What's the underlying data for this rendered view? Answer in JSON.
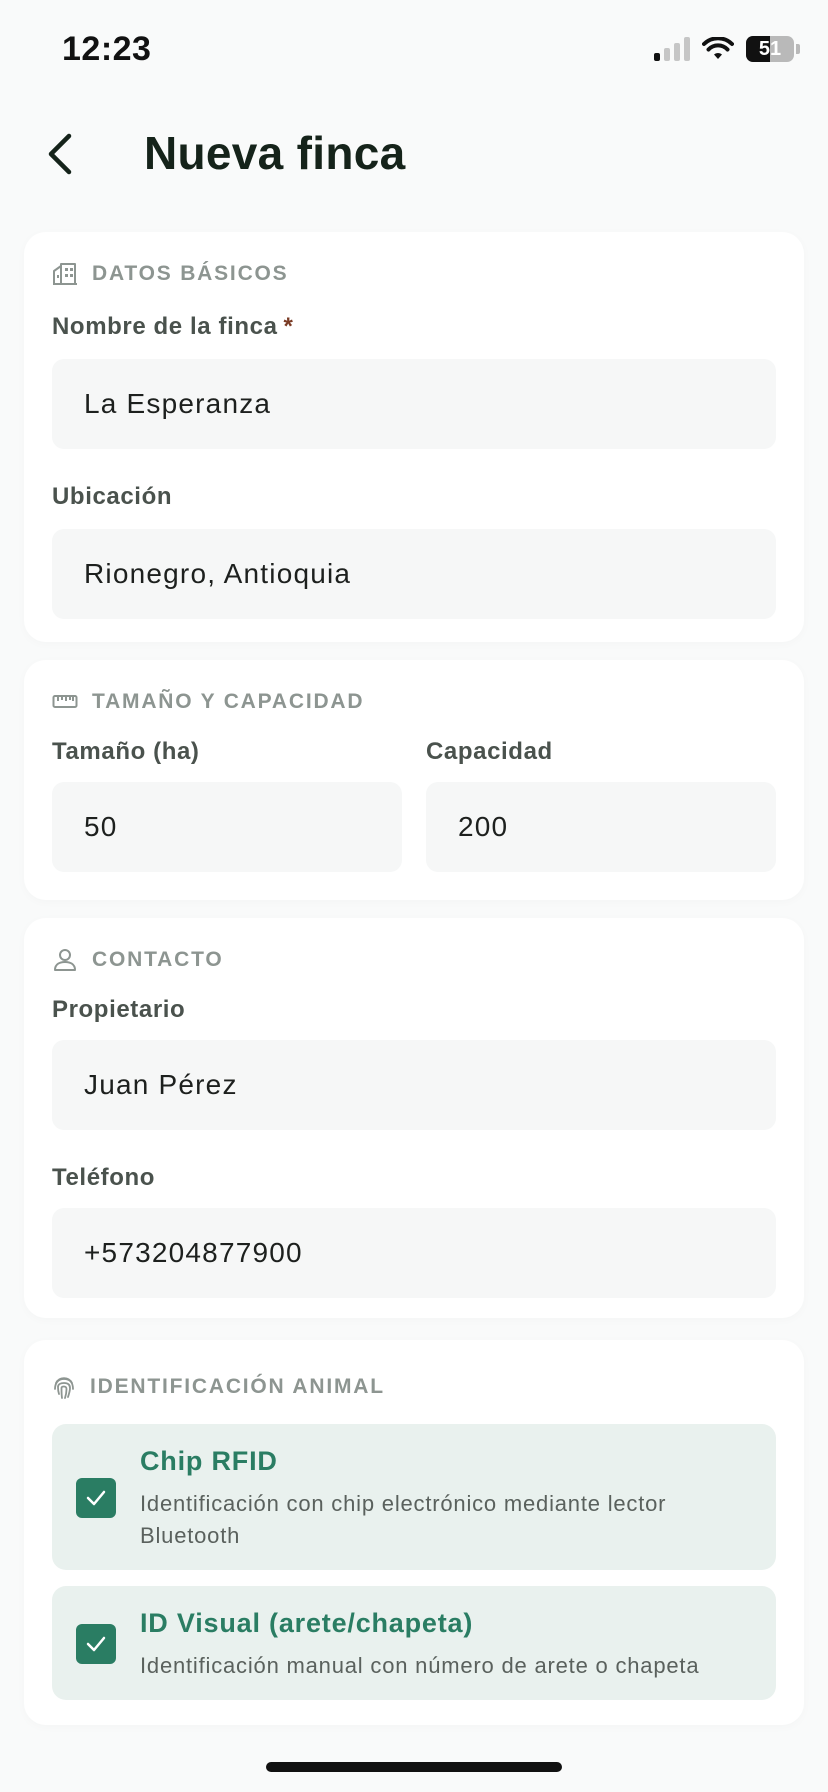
{
  "status_bar": {
    "time": "12:23",
    "battery": "51"
  },
  "header": {
    "title": "Nueva finca"
  },
  "basic": {
    "section_title": "DATOS BÁSICOS",
    "name_label": "Nombre de la finca",
    "required_mark": "*",
    "name_value": "La Esperanza",
    "location_label": "Ubicación",
    "location_value": "Rionegro, Antioquia"
  },
  "size": {
    "section_title": "TAMAÑO Y CAPACIDAD",
    "size_label": "Tamaño (ha)",
    "size_value": "50",
    "capacity_label": "Capacidad",
    "capacity_value": "200"
  },
  "contact": {
    "section_title": "CONTACTO",
    "owner_label": "Propietario",
    "owner_value": "Juan Pérez",
    "phone_label": "Teléfono",
    "phone_value": "+573204877900"
  },
  "identification": {
    "section_title": "IDENTIFICACIÓN ANIMAL",
    "options": [
      {
        "title": "Chip RFID",
        "description": "Identificación con chip electrónico mediante lector Bluetooth",
        "checked": true
      },
      {
        "title": "ID Visual (arete/chapeta)",
        "description": "Identificación manual con número de arete o chapeta",
        "checked": true
      }
    ]
  },
  "colors": {
    "accent": "#2a7d63",
    "option_bg": "#e9f1ee",
    "input_bg": "#f6f7f7"
  }
}
